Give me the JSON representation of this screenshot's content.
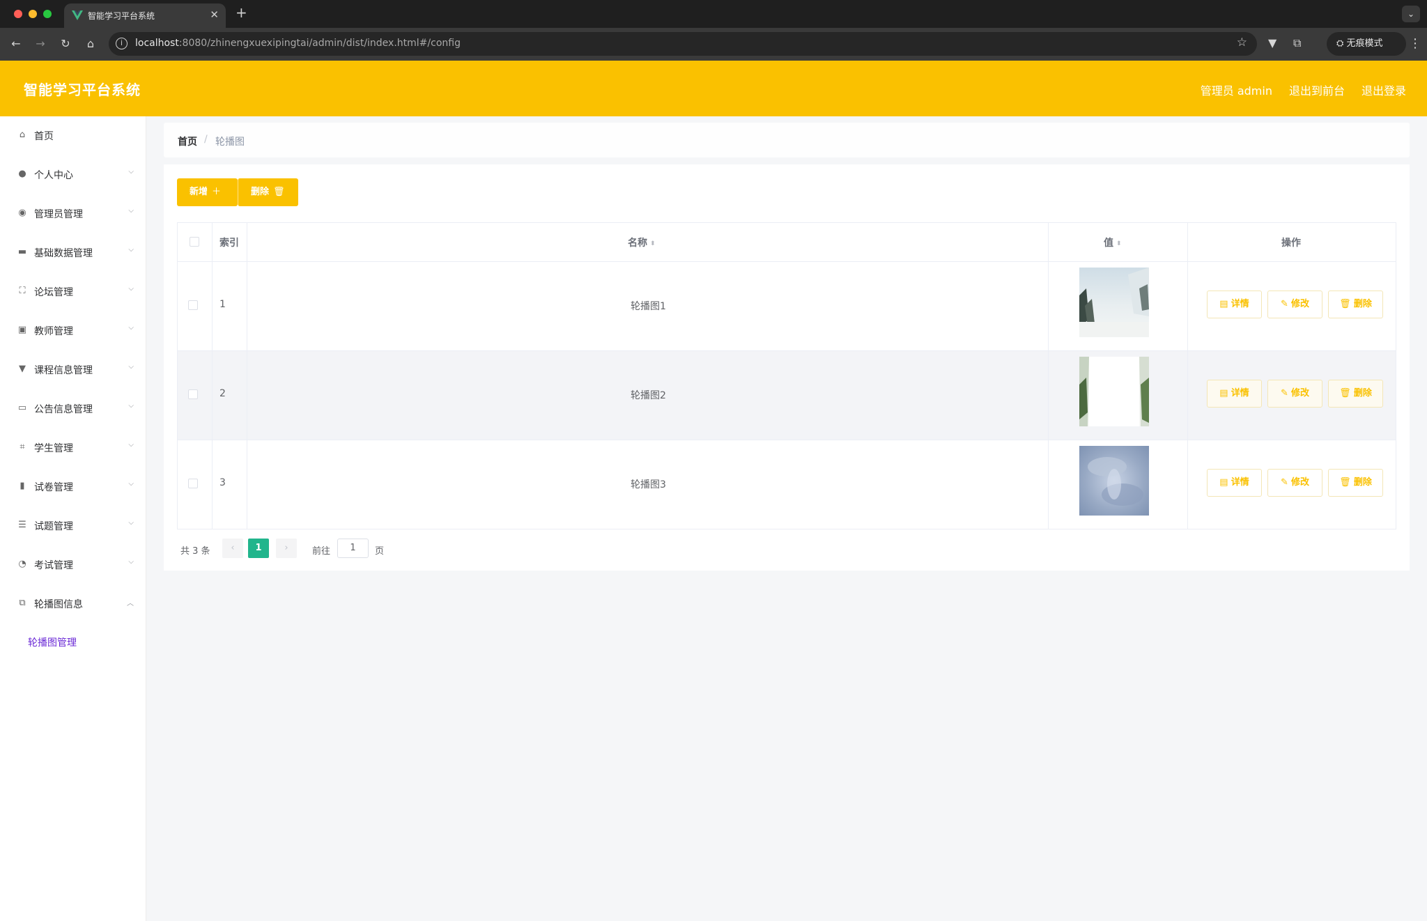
{
  "browser": {
    "tab_title": "智能学习平台系统",
    "url_host": "localhost",
    "url_rest": ":8080/zhinengxuexipingtai/admin/dist/index.html#/config",
    "incognito_label": "无痕模式",
    "icons": [
      "back-icon",
      "forward-icon",
      "reload-icon",
      "home-icon",
      "info-icon",
      "star-icon",
      "extension-icon",
      "incognito-icon",
      "menu-icon"
    ]
  },
  "header": {
    "title": "智能学习平台系统",
    "user": "管理员 admin",
    "to_front": "退出到前台",
    "logout": "退出登录",
    "color": "#fac100"
  },
  "sidebar": {
    "items": [
      {
        "label": "首页",
        "icon": "home-icon"
      },
      {
        "label": "个人中心",
        "icon": "user-icon"
      },
      {
        "label": "管理员管理",
        "icon": "admin-icon"
      },
      {
        "label": "基础数据管理",
        "icon": "data-icon"
      },
      {
        "label": "论坛管理",
        "icon": "forum-icon"
      },
      {
        "label": "教师管理",
        "icon": "teacher-icon"
      },
      {
        "label": "课程信息管理",
        "icon": "course-icon"
      },
      {
        "label": "公告信息管理",
        "icon": "notice-icon"
      },
      {
        "label": "学生管理",
        "icon": "student-icon"
      },
      {
        "label": "试卷管理",
        "icon": "paper-icon"
      },
      {
        "label": "试题管理",
        "icon": "question-icon"
      },
      {
        "label": "考试管理",
        "icon": "exam-icon"
      },
      {
        "label": "轮播图信息",
        "icon": "carousel-icon"
      }
    ],
    "sub_item": "轮播图管理"
  },
  "breadcrumb": {
    "home": "首页",
    "separator": "/",
    "current": "轮播图"
  },
  "toolbar": {
    "add_label": "新增",
    "delete_label": "删除"
  },
  "table": {
    "columns": [
      "索引",
      "名称",
      "值",
      "操作"
    ],
    "rows": [
      {
        "index": "1",
        "name": "轮播图1"
      },
      {
        "index": "2",
        "name": "轮播图2"
      },
      {
        "index": "3",
        "name": "轮播图3"
      }
    ],
    "actions": {
      "detail": "详情",
      "edit": "修改",
      "delete": "删除"
    }
  },
  "pagination": {
    "total_text": "共 3 条",
    "current_page": "1",
    "goto_label": "前往",
    "goto_value": "1",
    "page_unit": "页"
  }
}
